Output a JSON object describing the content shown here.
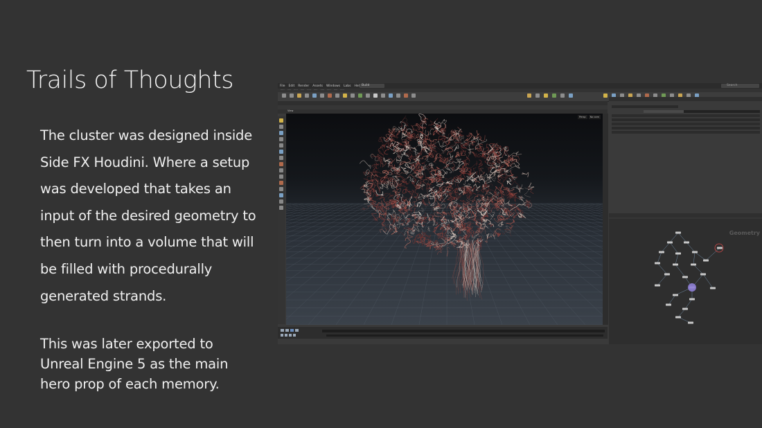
{
  "slide": {
    "title": "Trails of Thoughts",
    "paragraph1": [
      "The cluster was designed inside",
      "Side FX Houdini. Where a setup",
      "was developed that takes an",
      "input of the desired geometry to",
      "then turn into a volume that will",
      "be filled with procedurally",
      "generated strands."
    ],
    "paragraph2": [
      "This was later exported to",
      "Unreal Engine 5 as the main",
      "hero prop of each memory."
    ]
  },
  "houdini": {
    "menu": [
      "File",
      "Edit",
      "Render",
      "Assets",
      "Windows",
      "Labs",
      "Help"
    ],
    "desktop": "Build",
    "search": "Search",
    "viewport_label": "View",
    "view_buttons": [
      "Persp",
      "No cam"
    ],
    "network_watermark": "Geometry",
    "colors": {
      "background": "#333333",
      "viewport_top": "#0c0d10",
      "strand_red": "#9a4a44",
      "strand_light": "#d8c8c0"
    }
  }
}
